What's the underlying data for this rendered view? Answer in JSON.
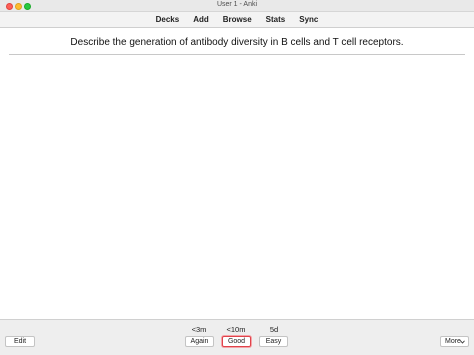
{
  "window": {
    "title": "User 1 - Anki"
  },
  "toolbar": {
    "items": [
      "Decks",
      "Add",
      "Browse",
      "Stats",
      "Sync"
    ]
  },
  "card": {
    "question": "Describe the generation of antibody diversity in B cells and T cell receptors."
  },
  "bottom": {
    "edit_label": "Edit",
    "more_label": "More",
    "more_icon": "chevron-down-icon",
    "answers": [
      {
        "interval": "<3m",
        "label": "Again"
      },
      {
        "interval": "<10m",
        "label": "Good"
      },
      {
        "interval": "5d",
        "label": "Easy"
      }
    ],
    "highlight_color": "#e0434b"
  }
}
